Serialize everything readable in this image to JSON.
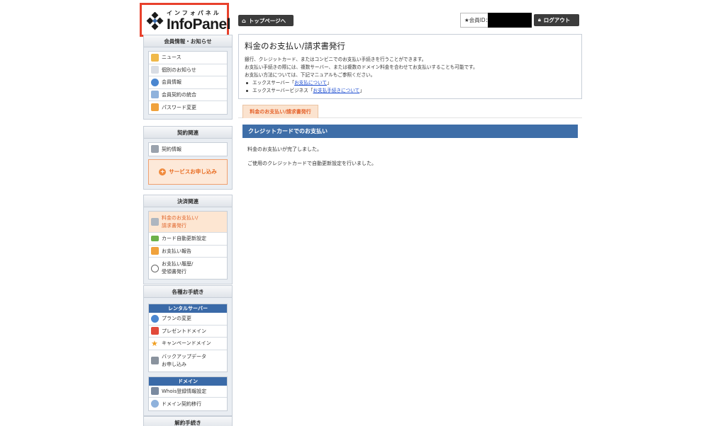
{
  "logo": {
    "kana": "インフォパネル",
    "brand": "InfoPanel",
    "highlight_color": "#e8412c"
  },
  "topbar": {
    "home_label": "トップページへ",
    "member_label": "★会員ID：",
    "logout_label": "ログアウト"
  },
  "sidebar": {
    "sections": [
      {
        "title": "会員情報・お知らせ",
        "items": [
          {
            "label": "ニュース",
            "icon": "news-icon"
          },
          {
            "label": "個別のお知らせ",
            "icon": "mail-icon"
          },
          {
            "label": "会員情報",
            "icon": "user-icon"
          },
          {
            "label": "会員契約の統合",
            "icon": "merge-icon"
          },
          {
            "label": "パスワード変更",
            "icon": "lock-icon"
          }
        ]
      },
      {
        "title": "契約関連",
        "items": [
          {
            "label": "契約情報",
            "icon": "contract-icon"
          }
        ],
        "button": "サービスお申し込み"
      },
      {
        "title": "決済関連",
        "items": [
          {
            "label": "料金のお支払い/\n請求書発行",
            "icon": "invoice-icon",
            "active": true
          },
          {
            "label": "カード自動更新設定",
            "icon": "card-icon"
          },
          {
            "label": "お支払い報告",
            "icon": "report-icon"
          },
          {
            "label": "お支払い履歴/\n受領書発行",
            "icon": "clock-icon"
          }
        ]
      },
      {
        "title": "各種お手続き",
        "groups": [
          {
            "subtitle": "レンタルサーバー",
            "items": [
              {
                "label": "プランの変更",
                "icon": "refresh-icon"
              },
              {
                "label": "プレゼントドメイン",
                "icon": "gift-icon"
              },
              {
                "label": "キャンペーンドメイン",
                "icon": "star-icon"
              },
              {
                "label": "バックアップデータ\nお申し込み",
                "icon": "backup-icon"
              }
            ]
          },
          {
            "subtitle": "ドメイン",
            "items": [
              {
                "label": "Whois登録情報設定",
                "icon": "whois-icon"
              },
              {
                "label": "ドメイン契約移行",
                "icon": "transfer-icon"
              }
            ]
          }
        ]
      },
      {
        "title": "解約手続き"
      }
    ]
  },
  "main": {
    "title": "料金のお支払い/請求書発行",
    "desc1": "銀行、クレジットカード、またはコンビニでのお支払い手続きを行うことができます。",
    "desc2": "お支払い手続きの際には、複数サーバー、または複数のドメイン料金を合わせてお支払いすることも可能です。",
    "desc3": "お支払い方法については、下記マニュアルもご参照ください。",
    "bullet1_prefix": "エックスサーバー「",
    "bullet1_link": "お支払について",
    "bullet1_suffix": "」",
    "bullet2_prefix": "エックスサーバービジネス「",
    "bullet2_link": "お支払手続きについて",
    "bullet2_suffix": "」",
    "tab_label": "料金のお支払い/請求書発行",
    "panel_title": "クレジットカードでのお支払い",
    "panel_text1": "料金のお支払いが完了しました。",
    "panel_text2": "ご使用のクレジットカードで自動更新設定を行いました。"
  },
  "colors": {
    "accent": "#3e6ea8",
    "active_bg": "#fde6d2",
    "active_text": "#e0642a",
    "dark_button": "#3c3c3c"
  }
}
